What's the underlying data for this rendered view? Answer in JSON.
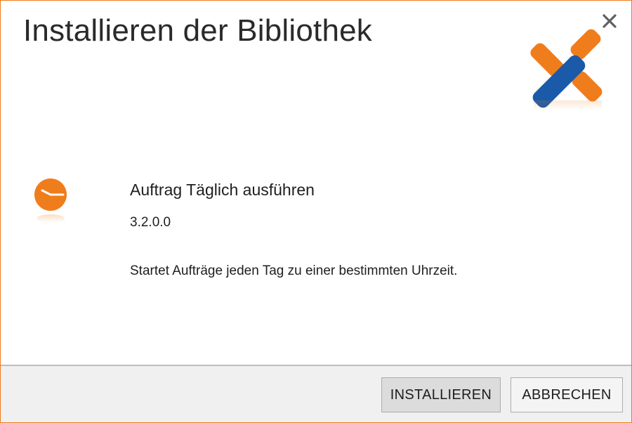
{
  "dialog": {
    "title": "Installieren der Bibliothek",
    "close_icon": "close-icon"
  },
  "logo": {
    "icon": "app-logo-x",
    "colors": {
      "orange": "#f07d1c",
      "blue": "#1a5aa8"
    }
  },
  "item": {
    "icon": "clock-icon",
    "icon_color": "#f07d1c",
    "name": "Auftrag Täglich ausführen",
    "version": "3.2.0.0",
    "description": "Startet Aufträge jeden Tag zu einer bestimmten Uhrzeit."
  },
  "footer": {
    "install_label": "INSTALLIEREN",
    "cancel_label": "ABBRECHEN"
  },
  "colors": {
    "accent": "#f07d1c",
    "footer_bg": "#f0f0f0",
    "text": "#1e1e1e"
  }
}
